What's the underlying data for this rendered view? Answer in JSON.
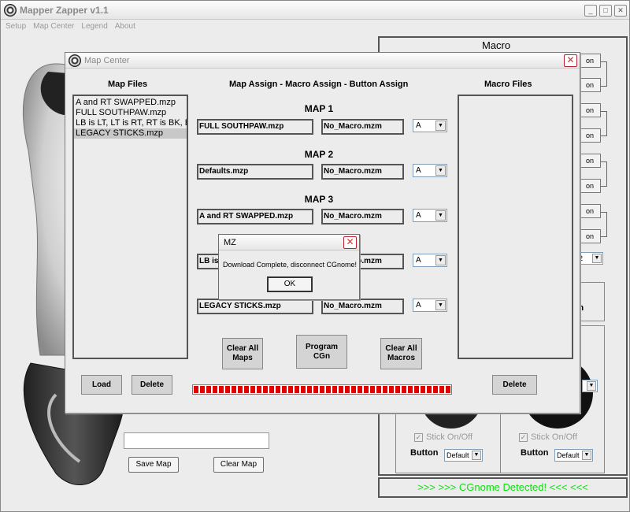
{
  "app": {
    "title": "Mapper Zapper v1.1",
    "menu": [
      "Setup",
      "Map Center",
      "Legend",
      "About"
    ],
    "window_buttons": {
      "minimize": "_",
      "maximize": "□",
      "close": "✕"
    }
  },
  "main": {
    "map_name_input": "",
    "save_map_label": "Save Map",
    "clear_map_label": "Clear Map",
    "macro_panel": {
      "title": "Macro",
      "button_labels": [
        "on",
        "on",
        "on",
        "on",
        "on",
        "on",
        "on",
        "on"
      ],
      "bottom_combo_value": "2",
      "partial_labels": {
        "custom": "tom",
        "stick_title": "k"
      },
      "left_stick": {
        "checkbox_label": "Stick On/Off",
        "button_label": "Button",
        "combo_value": "Default",
        "checked": true
      },
      "right_stick": {
        "checkbox_label": "Stick On/Off",
        "button_label": "Button",
        "combo_value": "Default",
        "checked": true
      }
    },
    "status_text": ">>> >>> CGnome Detected! <<< <<<",
    "colors": {
      "status_text": "#10E010",
      "progress": "#E00000"
    }
  },
  "map_center": {
    "title": "Map Center",
    "map_files_title": "Map Files",
    "assign_title": "Map Assign - Macro Assign - Button Assign",
    "macro_files_title": "Macro Files",
    "map_files": [
      "A and RT SWAPPED.mzp",
      "FULL SOUTHPAW.mzp",
      "LB is LT, LT is RT, RT is BK, B",
      "LEGACY STICKS.mzp"
    ],
    "selected_map_file_index": 3,
    "macro_files": [],
    "maps": [
      {
        "label": "MAP 1",
        "map": "FULL SOUTHPAW.mzp",
        "macro": "No_Macro.mzm",
        "button": "A"
      },
      {
        "label": "MAP 2",
        "map": "Defaults.mzp",
        "macro": "No_Macro.mzm",
        "button": "A"
      },
      {
        "label": "MAP 3",
        "map": "A and RT SWAPPED.mzp",
        "macro": "No_Macro.mzm",
        "button": "A"
      },
      {
        "label": "MAP 4",
        "map": "LB is",
        "macro": "No_Macro.mzm",
        "button": "A"
      },
      {
        "label": "MAP 5",
        "map": "LEGACY STICKS.mzp",
        "macro": "No_Macro.mzm",
        "button": "A"
      }
    ],
    "load_label": "Load",
    "delete_label": "Delete",
    "macro_delete_label": "Delete",
    "clear_all_maps_line1": "Clear All",
    "clear_all_maps_line2": "Maps",
    "program_line1": "Program",
    "program_line2": "CGn",
    "clear_all_macros_line1": "Clear All",
    "clear_all_macros_line2": "Macros",
    "progress_percent": 100
  },
  "dialog": {
    "title": "MZ",
    "message": "Download Complete, disconnect CGnome!",
    "ok_label": "OK"
  }
}
